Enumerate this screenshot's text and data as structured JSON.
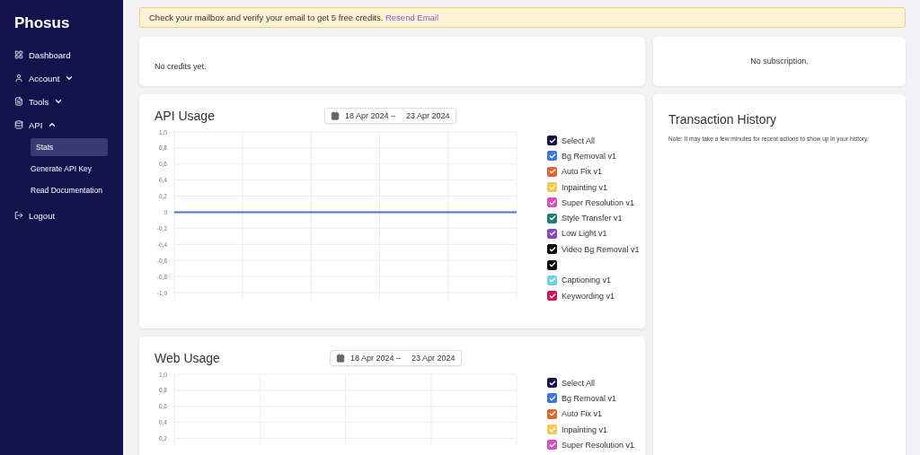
{
  "sidebar": {
    "logo": "Phosus",
    "items": [
      {
        "kind": "link",
        "label": "Dashboard"
      },
      {
        "kind": "group",
        "label": "Account",
        "expanded": false
      },
      {
        "kind": "group",
        "label": "Tools",
        "expanded": false
      },
      {
        "kind": "group",
        "label": "API",
        "expanded": true,
        "children": [
          {
            "label": "Stats",
            "selected": true
          },
          {
            "label": "Generate API Key",
            "selected": false
          },
          {
            "label": "Read Documentation",
            "selected": false
          }
        ]
      },
      {
        "kind": "link",
        "label": "Logout"
      }
    ]
  },
  "banner": {
    "message": "Check your mailbox and verify your email to get 5 free credits.",
    "link": "Resend Email"
  },
  "credits_card": {
    "message": "No credits yet."
  },
  "subscription_card": {
    "message": "No subscription."
  },
  "api_usage": {
    "title": "API Usage",
    "date_start": "18 Apr 2024 –",
    "date_end": "23 Apr 2024",
    "chart_data": {
      "type": "line",
      "grid": true,
      "categories": [
        null,
        null,
        null,
        null,
        null,
        null
      ],
      "yticks": [
        {
          "value": 1,
          "label": "1,0"
        },
        {
          "value": 0.8,
          "label": "0,8"
        },
        {
          "value": 0.6,
          "label": "0,6"
        },
        {
          "value": 0.4,
          "label": "0,4"
        },
        {
          "value": 0.2,
          "label": "0,2"
        },
        {
          "value": 0,
          "label": "0"
        },
        {
          "value": -0.2,
          "label": "-0,2"
        },
        {
          "value": -0.4,
          "label": "-0,4"
        },
        {
          "value": -0.6,
          "label": "-0,6"
        },
        {
          "value": -0.8,
          "label": "-0,8"
        },
        {
          "value": -1,
          "label": "-1,0"
        }
      ],
      "ylim": [
        -1,
        1
      ],
      "series": [
        {
          "color": "#4a72d4",
          "values": [
            0,
            0,
            0,
            0,
            0,
            0
          ]
        }
      ]
    },
    "legend": [
      {
        "label": "Select All",
        "checked": true,
        "color": "#14124a"
      },
      {
        "label": "Bg Removal v1",
        "checked": true,
        "color": "#3d74e0"
      },
      {
        "label": "Auto Fix v1",
        "checked": true,
        "color": "#e0662d"
      },
      {
        "label": "Inpainting v1",
        "checked": true,
        "color": "#f5c84e"
      },
      {
        "label": "Super Resolution v1",
        "checked": true,
        "color": "#d94fc2"
      },
      {
        "label": "Style Transfer v1",
        "checked": true,
        "color": "#1f7f72"
      },
      {
        "label": "Low Light v1",
        "checked": true,
        "color": "#8b45c4"
      },
      {
        "label": "Video Bg Removal v1",
        "checked": true,
        "color": "#0a0a0a"
      },
      {
        "checked": true,
        "color": "#0a0a0a"
      },
      {
        "label": "Captioning v1",
        "checked": true,
        "color": "#66d3df"
      },
      {
        "label": "Keywording v1",
        "checked": true,
        "color": "#d1145a"
      }
    ]
  },
  "web_usage": {
    "title": "Web Usage",
    "date_start": "18 Apr 2024 –",
    "date_end": "23 Apr 2024",
    "chart_data": {
      "type": "line",
      "grid": true,
      "categories": [
        null,
        null,
        null,
        null,
        null
      ],
      "ylim": [
        0.2,
        1
      ],
      "yticks": [
        {
          "value": 1,
          "label": "1,0"
        },
        {
          "value": 0.8,
          "label": "0,8"
        },
        {
          "value": 0.6,
          "label": "0,6"
        },
        {
          "value": 0.4,
          "label": "0,4"
        },
        {
          "value": 0.2,
          "label": "0,2"
        }
      ]
    },
    "legend": [
      {
        "label": "Select All",
        "checked": true,
        "color": "#14124a"
      },
      {
        "label": "Bg Removal v1",
        "checked": true,
        "color": "#3d74e0"
      },
      {
        "label": "Auto Fix v1",
        "checked": true,
        "color": "#e0662d"
      },
      {
        "label": "Inpainting v1",
        "checked": true,
        "color": "#f5c84e"
      },
      {
        "label": "Super Resolution v1",
        "checked": true,
        "color": "#d94fc2"
      }
    ]
  },
  "transaction_history": {
    "title": "Transaction History",
    "note": "Note: It may take a few minutes for recent actions to show up in your history."
  }
}
